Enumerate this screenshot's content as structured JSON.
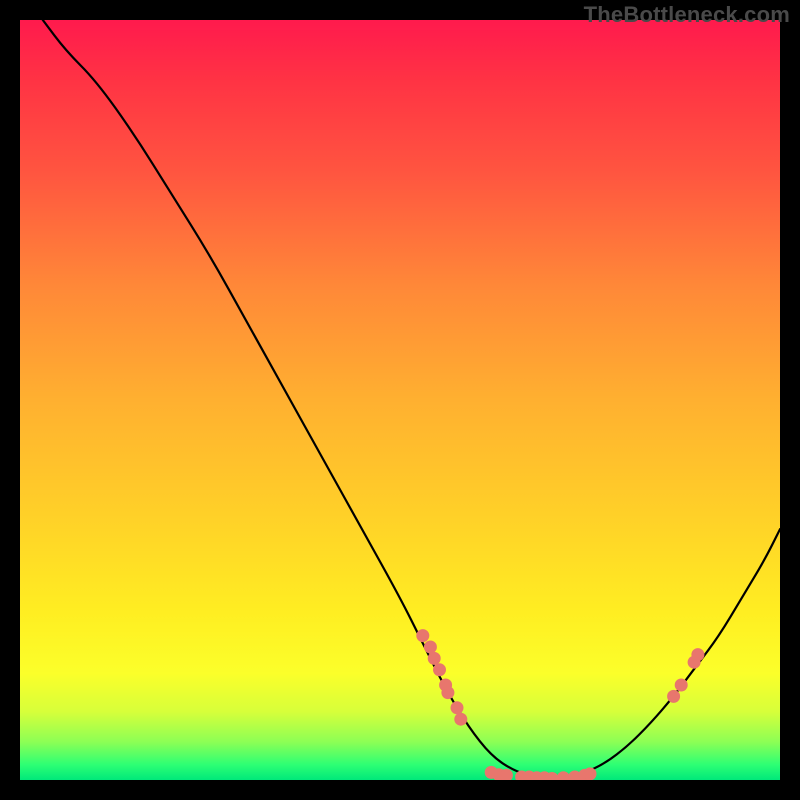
{
  "watermark": "TheBottleneck.com",
  "chart_data": {
    "type": "line",
    "title": "",
    "xlabel": "",
    "ylabel": "",
    "xlim": [
      0,
      100
    ],
    "ylim": [
      0,
      100
    ],
    "description": "Bottleneck percentage curve. Y ~ 0 (green) means optimal match; minimum around x ≈ 70. Curve rises steeply to the left (severe bottleneck) and moderately to the right.",
    "curve": [
      {
        "x": 3,
        "y": 100
      },
      {
        "x": 6,
        "y": 96
      },
      {
        "x": 10,
        "y": 92
      },
      {
        "x": 15,
        "y": 85
      },
      {
        "x": 20,
        "y": 77
      },
      {
        "x": 25,
        "y": 69
      },
      {
        "x": 30,
        "y": 60
      },
      {
        "x": 35,
        "y": 51
      },
      {
        "x": 40,
        "y": 42
      },
      {
        "x": 45,
        "y": 33
      },
      {
        "x": 50,
        "y": 24
      },
      {
        "x": 53,
        "y": 18
      },
      {
        "x": 56,
        "y": 12
      },
      {
        "x": 59,
        "y": 7
      },
      {
        "x": 62,
        "y": 3.2
      },
      {
        "x": 65,
        "y": 1.2
      },
      {
        "x": 68,
        "y": 0.3
      },
      {
        "x": 71,
        "y": 0.2
      },
      {
        "x": 74,
        "y": 0.8
      },
      {
        "x": 77,
        "y": 2.2
      },
      {
        "x": 80,
        "y": 4.5
      },
      {
        "x": 83,
        "y": 7.5
      },
      {
        "x": 86,
        "y": 11
      },
      {
        "x": 89,
        "y": 15
      },
      {
        "x": 92,
        "y": 19
      },
      {
        "x": 95,
        "y": 24
      },
      {
        "x": 98,
        "y": 29
      },
      {
        "x": 100,
        "y": 33
      }
    ],
    "markers": [
      {
        "x": 53,
        "y": 19
      },
      {
        "x": 54,
        "y": 17.5
      },
      {
        "x": 54.5,
        "y": 16
      },
      {
        "x": 55.2,
        "y": 14.5
      },
      {
        "x": 56,
        "y": 12.5
      },
      {
        "x": 56.3,
        "y": 11.5
      },
      {
        "x": 57.5,
        "y": 9.5
      },
      {
        "x": 58,
        "y": 8
      },
      {
        "x": 62,
        "y": 1
      },
      {
        "x": 63,
        "y": 0.7
      },
      {
        "x": 64,
        "y": 0.6
      },
      {
        "x": 66,
        "y": 0.4
      },
      {
        "x": 67,
        "y": 0.4
      },
      {
        "x": 68,
        "y": 0.3
      },
      {
        "x": 69,
        "y": 0.3
      },
      {
        "x": 70,
        "y": 0.2
      },
      {
        "x": 71.5,
        "y": 0.3
      },
      {
        "x": 73,
        "y": 0.4
      },
      {
        "x": 74.3,
        "y": 0.6
      },
      {
        "x": 75,
        "y": 0.8
      },
      {
        "x": 86,
        "y": 11
      },
      {
        "x": 87,
        "y": 12.5
      },
      {
        "x": 88.7,
        "y": 15.5
      },
      {
        "x": 89.2,
        "y": 16.5
      }
    ],
    "marker_color": "#e8766d",
    "curve_color": "#000000"
  }
}
